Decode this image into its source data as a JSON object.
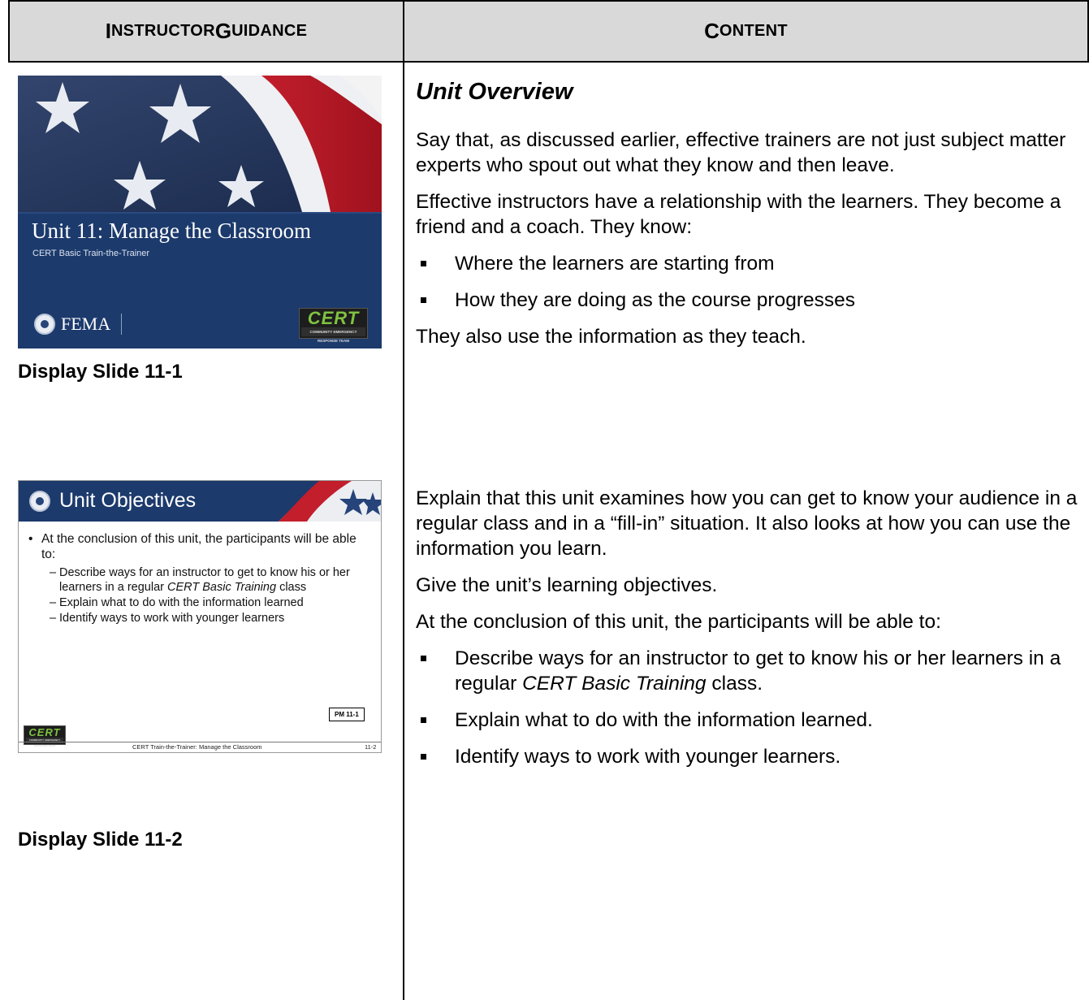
{
  "header": {
    "left_first": "I",
    "left_rest": "NSTRUCTOR ",
    "left_first2": "G",
    "left_rest2": "UIDANCE",
    "right_first": "C",
    "right_rest": "ONTENT"
  },
  "slide1": {
    "title": "Unit 11: Manage the Classroom",
    "subtitle": "CERT Basic Train-the-Trainer",
    "fema": "FEMA",
    "logo_word": "CERT",
    "logo_strip": "COMMUNITY EMERGENCY RESPONSE TEAM",
    "caption": "Display Slide 11-1"
  },
  "slide2": {
    "title": "Unit Objectives",
    "bullet": "At the conclusion of this unit, the participants will be able to:",
    "sub1_a": "Describe ways for an instructor to get to know his or her learners in a regular ",
    "sub1_i": "CERT Basic Training",
    "sub1_b": " class",
    "sub2": "Explain what to do with the information learned",
    "sub3": "Identify ways to work with younger learners",
    "pm": "PM 11-1",
    "logo_word": "CERT",
    "logo_strip": "COMMUNITY EMERGENCY RESPONSE TEAM",
    "footer": "CERT Train-the-Trainer:  Manage the Classroom",
    "page": "11-2",
    "caption": "Display Slide 11-2"
  },
  "section1": {
    "heading": "Unit Overview",
    "p1": "Say that, as discussed earlier, effective trainers are not just subject matter experts who spout out what they know and then leave.",
    "p2": "Effective instructors have a relationship with the learners. They become a friend and a coach. They know:",
    "b1": "Where the learners are starting from",
    "b2": "How they are doing as the course progresses",
    "p3": "They also use the information as they teach."
  },
  "section2": {
    "p1": "Explain that this unit examines how you can get to know your audience in a regular class and in a “fill-in” situation. It also looks at how you can use the information you learn.",
    "p2": "Give the unit’s learning objectives.",
    "p3": "At the conclusion of this unit, the participants will be able to:",
    "b1_a": "Describe ways for an instructor to get to know his or her learners in a regular ",
    "b1_i": "CERT Basic Training",
    "b1_b": " class.",
    "b2": "Explain what to do with the information learned.",
    "b3": "Identify ways to work with younger learners."
  }
}
